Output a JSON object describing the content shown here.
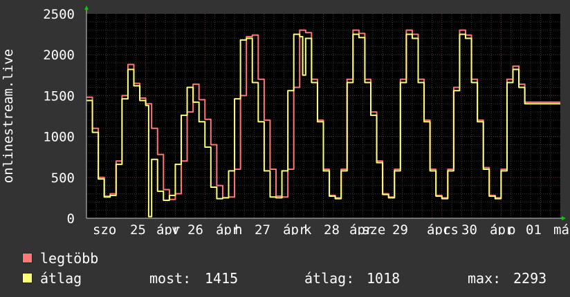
{
  "chart_data": {
    "type": "line",
    "ylabel": "onlinestream.live",
    "ylim": [
      0,
      2500
    ],
    "yticks": [
      "0",
      "500",
      "1000",
      "1500",
      "2000",
      "2500"
    ],
    "x_tick_labels": [
      "szo",
      "25",
      "ápr",
      "v",
      "26",
      "ápr",
      "h",
      "27",
      "ápr",
      "k",
      "28",
      "ápr",
      "sze",
      "29",
      "ápr",
      "cs",
      "30",
      "ápr",
      "p",
      "01",
      "má"
    ],
    "grid": true,
    "background": "#000000",
    "colors": {
      "page": "#333333",
      "grid": "#5a3b3b",
      "max": "#ff7777",
      "avg": "#ffff77"
    },
    "x_unit": "days since start of window",
    "series": [
      {
        "name": "legtöbb",
        "color": "#ff7777",
        "x": [
          0,
          0.1,
          0.2,
          0.3,
          0.4,
          0.5,
          0.6,
          0.7,
          0.8,
          0.9,
          1.0,
          1.1,
          1.2,
          1.3,
          1.4,
          1.5,
          1.6,
          1.7,
          1.8,
          1.9,
          2.0,
          2.1,
          2.2,
          2.3,
          2.4,
          2.5,
          2.6,
          2.7,
          2.8,
          2.9,
          3.0,
          3.1,
          3.2,
          3.3,
          3.4,
          3.5,
          3.6,
          3.7,
          3.8,
          3.9,
          4.0,
          4.1,
          4.2,
          4.3,
          4.4,
          4.5,
          4.6,
          4.7,
          4.8,
          4.9,
          5.0,
          5.1,
          5.2,
          5.3,
          5.4,
          5.5,
          5.6,
          5.7,
          5.8,
          5.9,
          6.0,
          6.1,
          6.2,
          6.3,
          6.4,
          6.5,
          6.6,
          6.7,
          6.8,
          6.9,
          7.0,
          7.1,
          7.2,
          7.3,
          7.4,
          7.5,
          7.6,
          7.7,
          7.8,
          7.9,
          8.0
        ],
        "values": [
          1480,
          1100,
          500,
          270,
          300,
          700,
          1500,
          1880,
          1650,
          1470,
          1400,
          1100,
          780,
          350,
          230,
          300,
          700,
          1300,
          1640,
          1450,
          1210,
          900,
          400,
          250,
          260,
          600,
          1500,
          2220,
          2240,
          1700,
          1200,
          600,
          270,
          260,
          600,
          1600,
          2300,
          2270,
          1700,
          1200,
          600,
          280,
          250,
          600,
          1700,
          2300,
          2260,
          1700,
          1300,
          700,
          300,
          260,
          600,
          1700,
          2300,
          2250,
          1700,
          1200,
          600,
          280,
          250,
          600,
          1600,
          2300,
          2240,
          1700,
          1200,
          620,
          280,
          250,
          600,
          1700,
          1860,
          1640,
          1420,
          1420,
          1420,
          1420,
          1420,
          1420,
          1420
        ]
      },
      {
        "name": "átlag",
        "color": "#ffff77",
        "x": [
          0,
          0.1,
          0.2,
          0.3,
          0.4,
          0.5,
          0.6,
          0.7,
          0.8,
          0.9,
          1.0,
          1.05,
          1.1,
          1.2,
          1.3,
          1.4,
          1.5,
          1.6,
          1.7,
          1.8,
          1.9,
          2.0,
          2.1,
          2.2,
          2.3,
          2.4,
          2.5,
          2.6,
          2.7,
          2.8,
          2.9,
          3.0,
          3.1,
          3.2,
          3.3,
          3.4,
          3.5,
          3.6,
          3.65,
          3.7,
          3.8,
          3.9,
          4.0,
          4.1,
          4.2,
          4.3,
          4.4,
          4.5,
          4.6,
          4.7,
          4.8,
          4.9,
          5.0,
          5.1,
          5.2,
          5.3,
          5.4,
          5.5,
          5.6,
          5.7,
          5.8,
          5.9,
          6.0,
          6.1,
          6.2,
          6.3,
          6.4,
          6.5,
          6.6,
          6.7,
          6.8,
          6.9,
          7.0,
          7.1,
          7.2,
          7.3,
          7.4,
          7.5,
          7.6,
          7.7,
          7.8,
          7.9,
          8.0
        ],
        "values": [
          1440,
          1050,
          480,
          260,
          280,
          660,
          1460,
          1820,
          1620,
          1440,
          1380,
          20,
          720,
          330,
          220,
          280,
          660,
          1260,
          1600,
          1420,
          1180,
          870,
          380,
          240,
          250,
          580,
          1460,
          2180,
          2200,
          1660,
          1180,
          580,
          260,
          250,
          580,
          1560,
          2250,
          2220,
          1750,
          2200,
          1660,
          1180,
          580,
          270,
          240,
          580,
          1660,
          2250,
          2210,
          1660,
          1260,
          680,
          290,
          250,
          580,
          1660,
          2250,
          2200,
          1660,
          1180,
          580,
          270,
          240,
          580,
          1560,
          2250,
          2200,
          1660,
          1180,
          600,
          270,
          240,
          580,
          1660,
          1820,
          1600,
          1400,
          1400,
          1400,
          1400,
          1400,
          1400,
          1400
        ]
      }
    ]
  },
  "legend": {
    "max_label": "legtöbb",
    "avg_label": "átlag",
    "stats": [
      {
        "label": "most:",
        "value": "1415"
      },
      {
        "label": "átlag:",
        "value": "1018"
      },
      {
        "label": "max:",
        "value": "2293"
      }
    ]
  }
}
